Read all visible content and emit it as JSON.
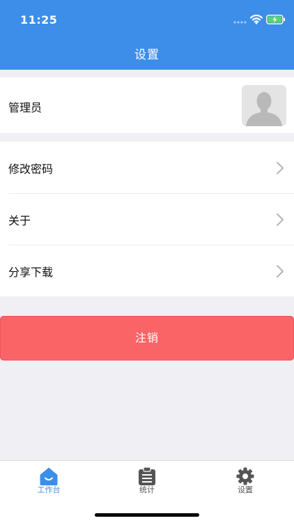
{
  "status_bar": {
    "time": "11:25"
  },
  "header": {
    "title": "设置"
  },
  "profile": {
    "name": "管理员"
  },
  "menu": {
    "items": [
      {
        "label": "修改密码"
      },
      {
        "label": "关于"
      },
      {
        "label": "分享下载"
      }
    ]
  },
  "logout": {
    "label": "注销"
  },
  "tabbar": {
    "tabs": [
      {
        "label": "工作台",
        "icon": "home-icon",
        "active": true
      },
      {
        "label": "统计",
        "icon": "clipboard-icon",
        "active": false
      },
      {
        "label": "设置",
        "icon": "gear-icon",
        "active": false
      }
    ]
  },
  "colors": {
    "primary": "#3d8ee8",
    "danger": "#fb6467",
    "background": "#efeff4",
    "icon_gray": "#555555"
  }
}
